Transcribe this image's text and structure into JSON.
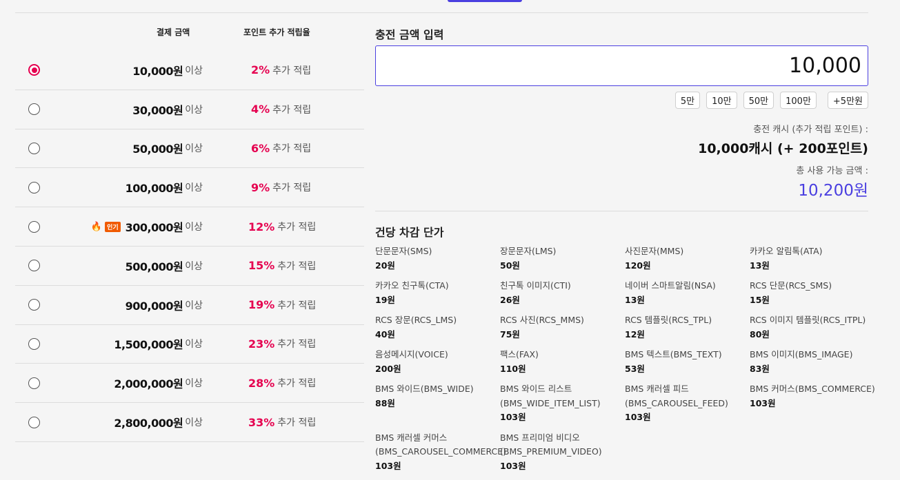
{
  "table": {
    "header_amount": "결제 금액",
    "header_rate": "포인트 추가 적립율",
    "above": "이상",
    "extra": "추가 적립",
    "popular_badge": "인기",
    "rows": [
      {
        "amount": "10,000원",
        "rate": "2%",
        "selected": true
      },
      {
        "amount": "30,000원",
        "rate": "4%"
      },
      {
        "amount": "50,000원",
        "rate": "6%"
      },
      {
        "amount": "100,000원",
        "rate": "9%"
      },
      {
        "amount": "300,000원",
        "rate": "12%",
        "popular": true
      },
      {
        "amount": "500,000원",
        "rate": "15%"
      },
      {
        "amount": "900,000원",
        "rate": "19%"
      },
      {
        "amount": "1,500,000원",
        "rate": "23%"
      },
      {
        "amount": "2,000,000원",
        "rate": "28%"
      },
      {
        "amount": "2,800,000원",
        "rate": "33%"
      }
    ]
  },
  "charge": {
    "title": "충전 금액 입력",
    "input_value": "10,000",
    "chips": [
      "5만",
      "10만",
      "50만",
      "100만"
    ],
    "plus_chip": "+5만원",
    "cash_label": "충전 캐시 (추가 적립 포인트) :",
    "cash_value": "10,000캐시 (+ 200포인트)",
    "total_label": "총 사용 가능 금액 :",
    "total_value": "10,200원"
  },
  "prices": {
    "title": "건당 차감 단가",
    "items": [
      {
        "name": "단문문자(SMS)",
        "price": "20원"
      },
      {
        "name": "장문문자(LMS)",
        "price": "50원"
      },
      {
        "name": "사진문자(MMS)",
        "price": "120원"
      },
      {
        "name": "카카오 알림톡(ATA)",
        "price": "13원"
      },
      {
        "name": "카카오 친구톡(CTA)",
        "price": "19원"
      },
      {
        "name": "친구톡 이미지(CTI)",
        "price": "26원"
      },
      {
        "name": "네이버 스마트알림(NSA)",
        "price": "13원"
      },
      {
        "name": "RCS 단문(RCS_SMS)",
        "price": "15원"
      },
      {
        "name": "RCS 장문(RCS_LMS)",
        "price": "40원"
      },
      {
        "name": "RCS 사진(RCS_MMS)",
        "price": "75원"
      },
      {
        "name": "RCS 템플릿(RCS_TPL)",
        "price": "12원"
      },
      {
        "name": "RCS 이미지 템플릿(RCS_ITPL)",
        "price": "80원"
      },
      {
        "name": "음성메시지(VOICE)",
        "price": "200원"
      },
      {
        "name": "팩스(FAX)",
        "price": "110원"
      },
      {
        "name": "BMS 텍스트(BMS_TEXT)",
        "price": "53원"
      },
      {
        "name": "BMS 이미지(BMS_IMAGE)",
        "price": "83원"
      },
      {
        "name": "BMS 와이드(BMS_WIDE)",
        "price": "88원"
      },
      {
        "name": "BMS 와이드 리스트",
        "name2": "(BMS_WIDE_ITEM_LIST)",
        "price": "103원"
      },
      {
        "name": "BMS 캐러셀 피드",
        "name2": "(BMS_CAROUSEL_FEED)",
        "price": "103원"
      },
      {
        "name": "BMS 커머스(BMS_COMMERCE)",
        "price": "103원"
      },
      {
        "name": "BMS 캐러셀 커머스",
        "name2": "(BMS_CAROUSEL_COMMERCE)",
        "price": "103원"
      },
      {
        "name": "BMS 프리미엄 비디오",
        "name2": "(BMS_PREMIUM_VIDEO)",
        "price": "103원"
      }
    ]
  },
  "colors": {
    "accent": "#4a3fe0",
    "rate": "#e5004f",
    "badge": "#f05a00"
  }
}
